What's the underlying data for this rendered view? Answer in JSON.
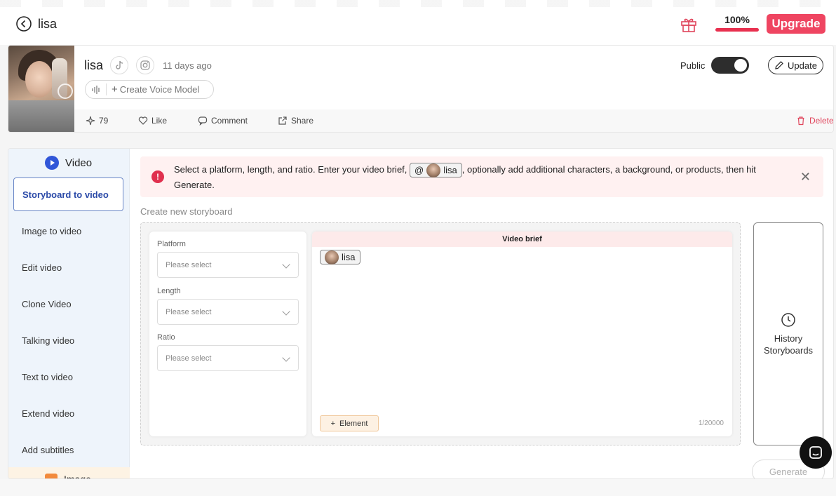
{
  "topbar": {
    "title": "lisa",
    "credit_percent": "100%",
    "credit_fill": 1.0,
    "upgrade_label": "Upgrade",
    "accent_color": "#ef4561"
  },
  "profile": {
    "name": "lisa",
    "time": "11 days ago",
    "voice_model_label": "Create Voice Model",
    "public_label": "Public",
    "public_on": true,
    "update_label": "Update",
    "stats": {
      "sparkles": "79",
      "like": "Like",
      "comment": "Comment",
      "share": "Share",
      "delete": "Delete"
    }
  },
  "sidebar": {
    "section_title": "Video",
    "items": [
      {
        "label": "Storyboard to video",
        "active": true
      },
      {
        "label": "Image to video"
      },
      {
        "label": "Edit video"
      },
      {
        "label": "Clone Video"
      },
      {
        "label": "Talking video"
      },
      {
        "label": "Text to video"
      },
      {
        "label": "Extend video"
      },
      {
        "label": "Add subtitles"
      }
    ],
    "next_section": "Image"
  },
  "notice": {
    "before": "Select a platform, length, and ratio. Enter your video brief,",
    "chip_at": "@",
    "chip_name": "lisa",
    "after": ", optionally add additional characters, a background, or products, then hit Generate."
  },
  "create_label": "Create new storyboard",
  "form": {
    "platform_label": "Platform",
    "platform_placeholder": "Please select",
    "length_label": "Length",
    "length_placeholder": "Please select",
    "ratio_label": "Ratio",
    "ratio_placeholder": "Please select"
  },
  "brief": {
    "header": "Video brief",
    "chip_name": "lisa",
    "element_label": "Element",
    "counter": "1/20000"
  },
  "history": {
    "line1": "History",
    "line2": "Storyboards"
  },
  "generate_label": "Generate"
}
